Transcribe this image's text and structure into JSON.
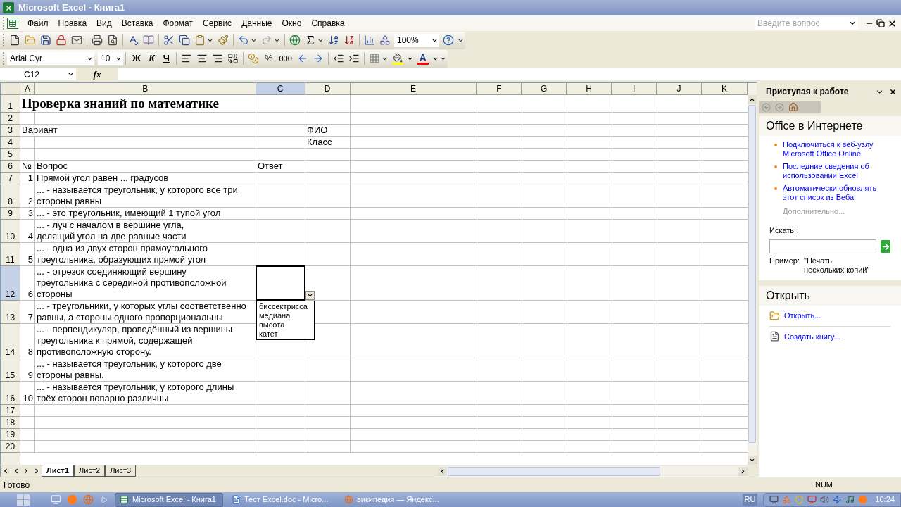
{
  "window": {
    "title": "Microsoft Excel - Книга1"
  },
  "menu": [
    "Файл",
    "Правка",
    "Вид",
    "Вставка",
    "Формат",
    "Сервис",
    "Данные",
    "Окно",
    "Справка"
  ],
  "help_box": {
    "placeholder": "Введите вопрос"
  },
  "standard_toolbar": {
    "zoom": "100%"
  },
  "formatting_toolbar": {
    "font": "Arial Cyr",
    "size": "10",
    "bold": "Ж",
    "italic": "К",
    "underline": "Ч",
    "percent": "%",
    "thousands": "000",
    "font_color": "A"
  },
  "formula_bar": {
    "name_box": "C12",
    "fx": "fx"
  },
  "columns": [
    {
      "label": "A",
      "selected": false
    },
    {
      "label": "B",
      "selected": false
    },
    {
      "label": "C",
      "selected": true
    },
    {
      "label": "D",
      "selected": false
    },
    {
      "label": "E",
      "selected": false
    },
    {
      "label": "F",
      "selected": false
    },
    {
      "label": "G",
      "selected": false
    },
    {
      "label": "H",
      "selected": false
    },
    {
      "label": "I",
      "selected": false
    },
    {
      "label": "J",
      "selected": false
    },
    {
      "label": "K",
      "selected": false
    }
  ],
  "rows": [
    {
      "number": "1",
      "selected": false,
      "kind": "title",
      "a": "Проверка знаний по математике"
    },
    {
      "number": "2",
      "selected": false,
      "kind": "text"
    },
    {
      "number": "3",
      "selected": false,
      "kind": "text",
      "a": "Вариант",
      "d": "ФИО"
    },
    {
      "number": "4",
      "selected": false,
      "kind": "text",
      "d": "Класс"
    },
    {
      "number": "5",
      "selected": false,
      "kind": "text"
    },
    {
      "number": "6",
      "selected": false,
      "kind": "text",
      "a": "№",
      "b": "Вопрос",
      "c": "Ответ"
    },
    {
      "number": "7",
      "selected": false,
      "kind": "question",
      "a": "1",
      "b": "Прямой угол равен ... градусов"
    },
    {
      "number": "8",
      "selected": false,
      "kind": "question",
      "a": "2",
      "b": "... - называется треугольник, у которого все три\nстороны равны"
    },
    {
      "number": "9",
      "selected": false,
      "kind": "question",
      "a": "3",
      "b": "... - это треугольник, имеющий 1 тупой угол"
    },
    {
      "number": "10",
      "selected": false,
      "kind": "question",
      "a": "4",
      "b": "... - луч с началом в вершине угла,\nделящий угол на две равные части"
    },
    {
      "number": "11",
      "selected": false,
      "kind": "question",
      "a": "5",
      "b": "... - одна из двух сторон прямоугольного\nтреугольника, образующих прямой угол"
    },
    {
      "number": "12",
      "selected": true,
      "kind": "question",
      "a": "6",
      "b": "... - отрезок соединяющий вершину\nтреугольника с серединой противоположной\nстороны"
    },
    {
      "number": "13",
      "selected": false,
      "kind": "question",
      "a": "7",
      "b": "... - треугольники, у которых углы соответственно\nравны, а стороны одного пропорциональны"
    },
    {
      "number": "14",
      "selected": false,
      "kind": "question",
      "a": "8",
      "b": "... - перпендикуляр, проведённый из вершины\nтреугольника к прямой, содержащей\nпротивоположную сторону."
    },
    {
      "number": "15",
      "selected": false,
      "kind": "question",
      "a": "9",
      "b": "... - называется треугольник, у которого две\nстороны равны."
    },
    {
      "number": "16",
      "selected": false,
      "kind": "question",
      "a": "10",
      "b": "... - называется треугольник, у которого длины\nтрёх сторон попарно различны"
    },
    {
      "number": "17",
      "selected": false,
      "kind": "text"
    },
    {
      "number": "18",
      "selected": false,
      "kind": "text"
    },
    {
      "number": "19",
      "selected": false,
      "kind": "text"
    },
    {
      "number": "20",
      "selected": false,
      "kind": "text"
    }
  ],
  "validation_list": {
    "items": [
      "биссектрисса",
      "медиана",
      "высота",
      "катет"
    ]
  },
  "sheet_tabs": [
    {
      "label": "Лист1",
      "selected": true
    },
    {
      "label": "Лист2",
      "selected": false
    },
    {
      "label": "Лист3",
      "selected": false
    }
  ],
  "task_pane": {
    "title": "Приступая к работе",
    "online": {
      "title": "Office в Интернете",
      "links": [
        "Подключиться к веб-узлу Microsoft Office Online",
        "Последние сведения об использовании Excel",
        "Автоматически обновлять этот список из Веба"
      ],
      "more": "Дополнительно...",
      "search_label": "Искать:",
      "example_label": "Пример:",
      "example": "\"Печать нескольких копий\""
    },
    "open": {
      "title": "Открыть",
      "items": [
        {
          "label": "Открыть...",
          "kind": "open"
        },
        {
          "label": "Создать книгу...",
          "kind": "new"
        }
      ]
    }
  },
  "status_bar": {
    "text": "Готово",
    "num": "NUM"
  },
  "taskbar": {
    "tasks": [
      {
        "label": "Microsoft Excel - Книга1",
        "selected": true,
        "kind": "excel"
      },
      {
        "label": "Тест Excel.doc - Micro...",
        "selected": false,
        "kind": "word"
      },
      {
        "label": "википедия — Яндекс...",
        "selected": false,
        "kind": "browser"
      }
    ],
    "language": "RU",
    "clock": "10:24"
  }
}
